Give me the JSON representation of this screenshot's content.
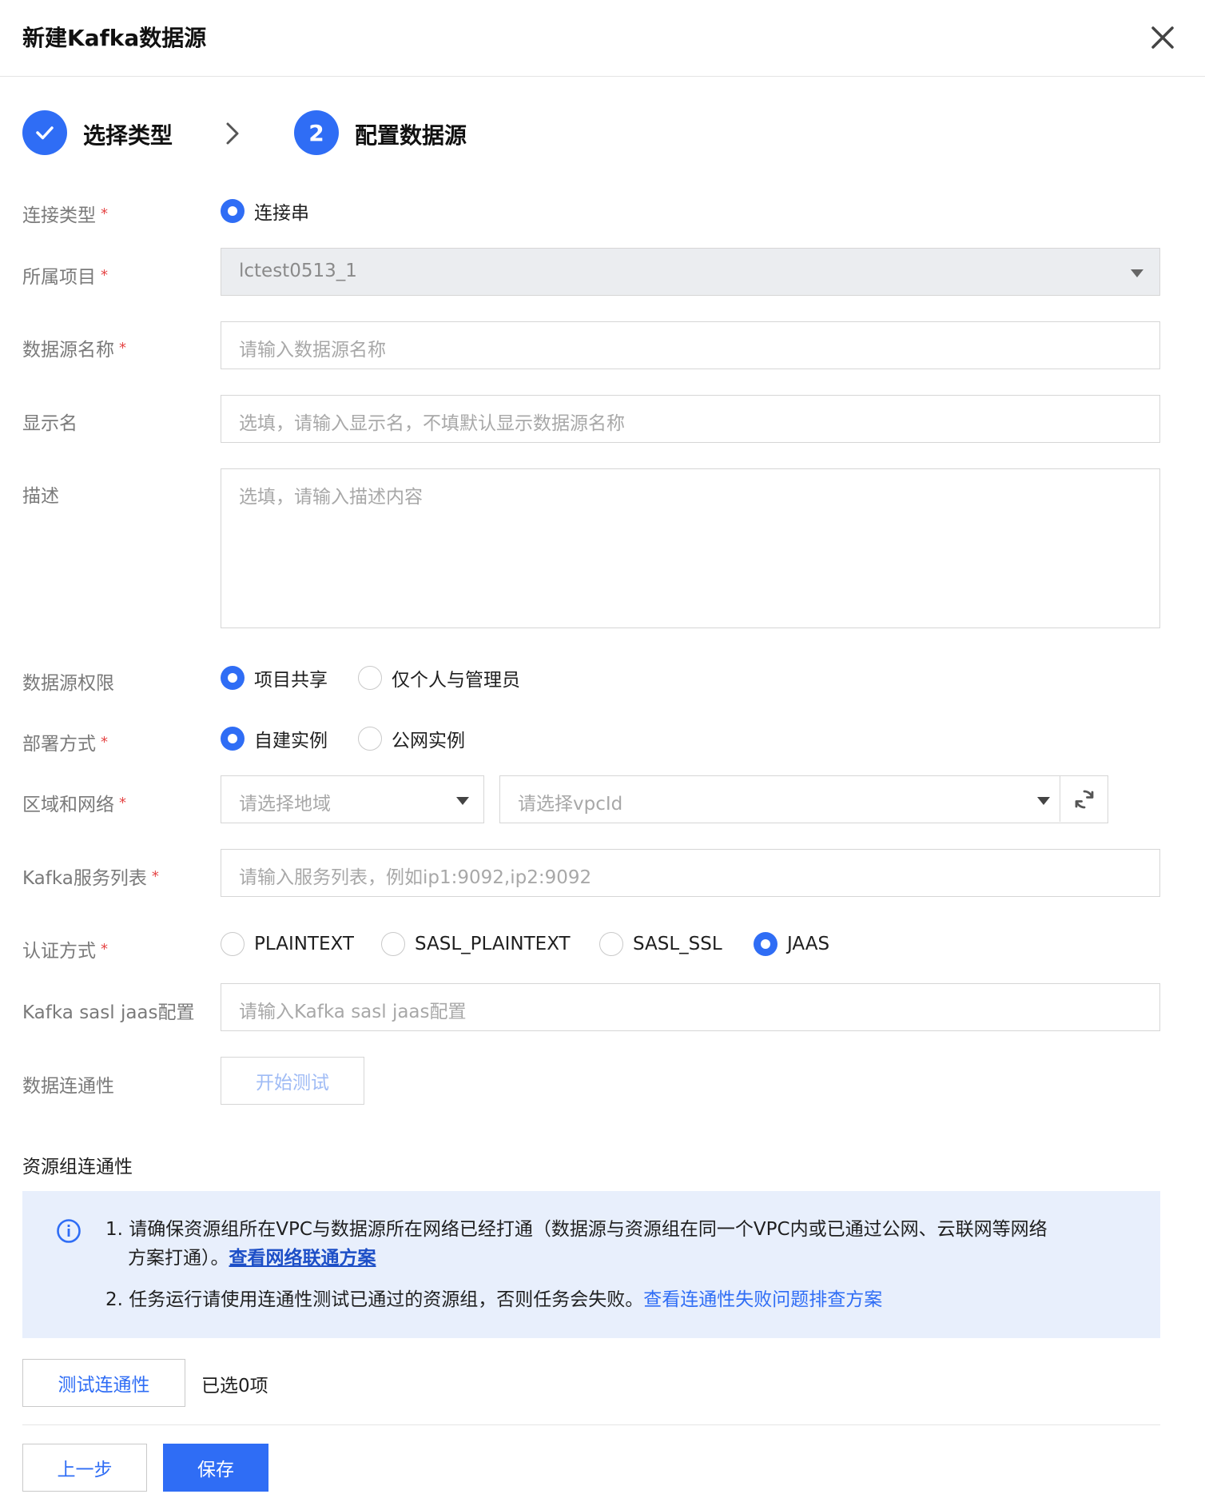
{
  "dialog": {
    "title": "新建Kafka数据源"
  },
  "steps": [
    {
      "label": "选择类型",
      "state": "done"
    },
    {
      "number": "2",
      "label": "配置数据源",
      "state": "active"
    }
  ],
  "form": {
    "connection_type": {
      "label": "连接类型",
      "required": "*",
      "options": [
        "连接串"
      ],
      "selected": "连接串"
    },
    "project": {
      "label": "所属项目",
      "required": "*",
      "value": "lctest0513_1"
    },
    "datasource_name": {
      "label": "数据源名称",
      "required": "*",
      "placeholder": "请输入数据源名称"
    },
    "display_name": {
      "label": "显示名",
      "placeholder": "选填，请输入显示名，不填默认显示数据源名称"
    },
    "description": {
      "label": "描述",
      "placeholder": "选填，请输入描述内容"
    },
    "permission": {
      "label": "数据源权限",
      "options": [
        "项目共享",
        "仅个人与管理员"
      ],
      "selected": "项目共享"
    },
    "deploy_mode": {
      "label": "部署方式",
      "required": "*",
      "options": [
        "自建实例",
        "公网实例"
      ],
      "selected": "自建实例"
    },
    "region_network": {
      "label": "区域和网络",
      "required": "*",
      "region_placeholder": "请选择地域",
      "vpc_placeholder": "请选择vpcId"
    },
    "kafka_servers": {
      "label": "Kafka服务列表",
      "required": "*",
      "placeholder": "请输入服务列表，例如ip1:9092,ip2:9092"
    },
    "auth_mode": {
      "label": "认证方式",
      "required": "*",
      "options": [
        "PLAINTEXT",
        "SASL_PLAINTEXT",
        "SASL_SSL",
        "JAAS"
      ],
      "selected": "JAAS"
    },
    "sasl_jaas": {
      "label": "Kafka sasl jaas配置",
      "placeholder": "请输入Kafka sasl jaas配置"
    },
    "connectivity": {
      "label": "数据连通性",
      "button": "开始测试"
    }
  },
  "resource_group": {
    "title": "资源组连通性",
    "notice": {
      "line1": "1. 请确保资源组所在VPC与数据源所在网络已经打通（数据源与资源组在同一个VPC内或已通过公网、云联网等网络",
      "line2_prefix": "方案打通）。",
      "line2_link": "查看网络联通方案",
      "line3_prefix": "2. 任务运行请使用连通性测试已通过的资源组，否则任务会失败。",
      "line3_link": "查看连通性失败问题排查方案"
    },
    "test_button": "测试连通性",
    "selected_count": "已选0项"
  },
  "footer": {
    "prev_button": "上一步",
    "save_button": "保存"
  },
  "colors": {
    "primary": "#2f6df5",
    "required": "#e54545",
    "notice_bg": "#e8effc"
  },
  "icons": {
    "close": "close-icon",
    "check": "check-icon",
    "chevron": "chevron-right-icon",
    "refresh": "refresh-icon",
    "info": "info-icon"
  }
}
